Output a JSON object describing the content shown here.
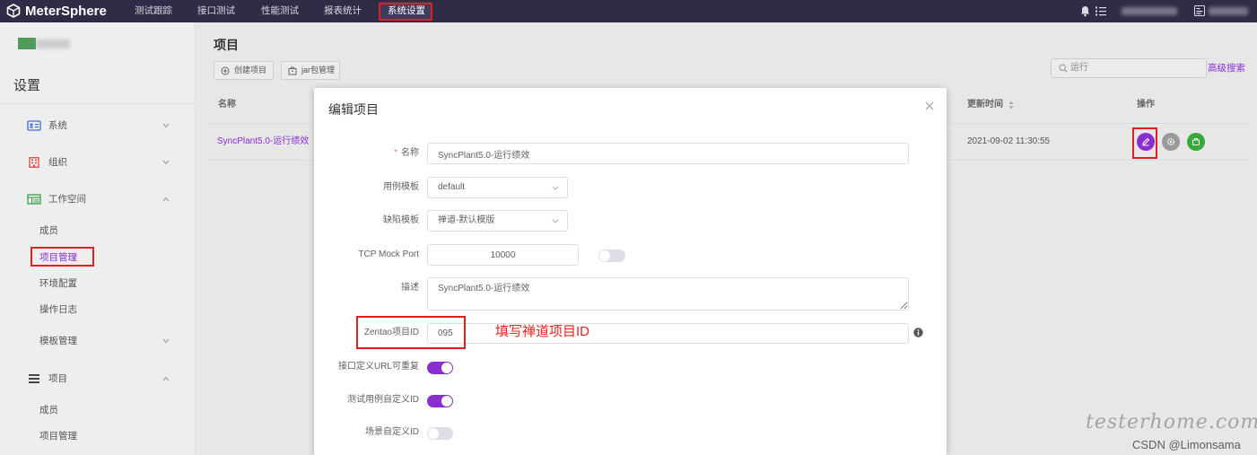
{
  "colors": {
    "topbar": "#2e2c47",
    "accent": "#8a2fcf",
    "highlight_red": "#e02020",
    "action_gray": "#9a9a9a",
    "action_green": "#38a838"
  },
  "topbar": {
    "logo_text": "MeterSphere",
    "logo_icon": "metersphere-cube-icon",
    "nav": [
      {
        "label": "测试跟踪"
      },
      {
        "label": "接口测试"
      },
      {
        "label": "性能测试"
      },
      {
        "label": "报表统计"
      },
      {
        "label": "系统设置",
        "active": true
      }
    ],
    "right_icons": [
      "bell-icon",
      "task-list-icon",
      "language-icon"
    ]
  },
  "sidebar": {
    "title": "设置",
    "menu": [
      {
        "label": "系统",
        "icon": "id-card-icon",
        "expanded": false
      },
      {
        "label": "组织",
        "icon": "building-icon",
        "expanded": false
      },
      {
        "label": "工作空间",
        "icon": "workspace-table-icon",
        "expanded": true,
        "children": [
          {
            "label": "成员"
          },
          {
            "label": "项目管理",
            "active": true
          },
          {
            "label": "环境配置"
          },
          {
            "label": "操作日志"
          },
          {
            "label": "模板管理",
            "expanded": false
          }
        ]
      },
      {
        "label": "项目",
        "icon": "menu-icon",
        "expanded": true,
        "children": [
          {
            "label": "成员"
          },
          {
            "label": "项目管理"
          }
        ]
      }
    ]
  },
  "main": {
    "title": "项目",
    "toolbar": {
      "create_label": "创建项目",
      "jar_label": "jar包管理"
    },
    "search": {
      "value": "运行",
      "icon": "search-icon"
    },
    "advanced_search_label": "高级搜索",
    "table": {
      "columns": [
        {
          "label": "名称"
        },
        {
          "label": "更新时间",
          "sortable": true
        },
        {
          "label": "操作"
        }
      ],
      "rows": [
        {
          "name": "SyncPlant5.0-运行绩效",
          "updated": "2021-09-02 11:30:55",
          "actions": [
            "edit-icon",
            "settings-icon",
            "briefcase-icon"
          ]
        }
      ]
    }
  },
  "modal": {
    "title": "编辑项目",
    "fields": {
      "name": {
        "label": "名称",
        "required_mark": "*",
        "value": "SyncPlant5.0-运行绩效"
      },
      "case_template": {
        "label": "用例模板",
        "value": "default"
      },
      "issue_template": {
        "label": "缺陷模板",
        "value": "禅道-默认模版"
      },
      "tcp_mock_port": {
        "label": "TCP Mock Port",
        "value": "10000",
        "enabled": false
      },
      "description": {
        "label": "描述",
        "value": "SyncPlant5.0-运行绩效"
      },
      "zentao_id": {
        "label": "Zentao项目ID",
        "value": "095"
      },
      "api_url_repeatable": {
        "label": "接口定义URL可重复",
        "enabled": true
      },
      "case_custom_id": {
        "label": "测试用例自定义ID",
        "enabled": true
      },
      "scenario_custom_id": {
        "label": "场景自定义ID",
        "enabled": false
      }
    }
  },
  "annotation": {
    "text": "填写禅道项目ID"
  },
  "watermark": {
    "site": "testerhome.com",
    "credit": "CSDN @Limonsama"
  }
}
